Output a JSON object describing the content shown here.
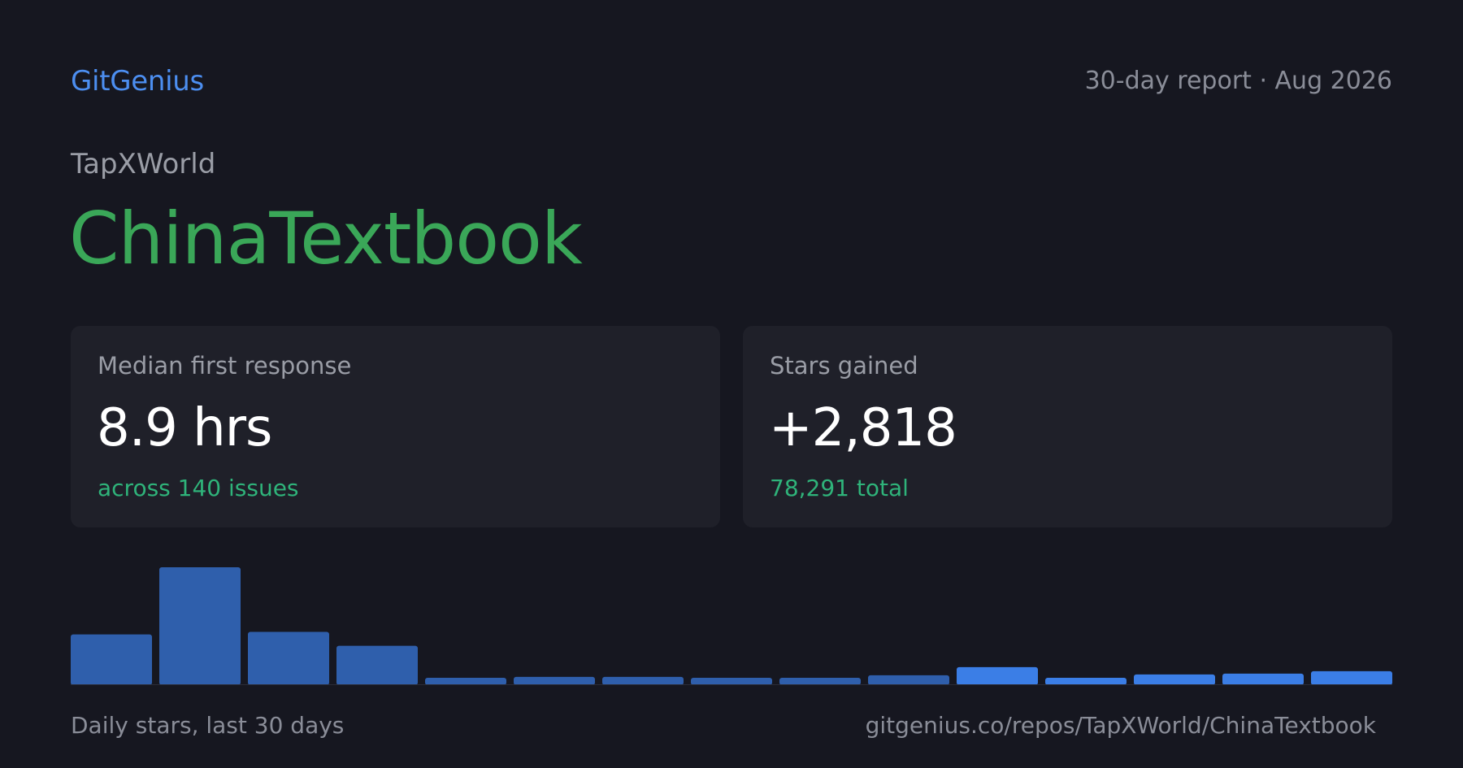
{
  "header": {
    "brand": "GitGenius",
    "report_label": "30-day report · Aug 2026"
  },
  "repo": {
    "owner": "TapXWorld",
    "name": "ChinaTextbook"
  },
  "cards": [
    {
      "label": "Median first response",
      "value": "8.9 hrs",
      "sub": "across 140 issues"
    },
    {
      "label": "Stars gained",
      "value": "+2,818",
      "sub": "78,291 total"
    }
  ],
  "footer": {
    "caption": "Daily stars, last 30 days",
    "url": "gitgenius.co/repos/TapXWorld/ChinaTextbook"
  },
  "colors": {
    "background": "#161720",
    "card": "#1f2029",
    "accent_blue": "#4c8ef0",
    "repo_green": "#3aa758",
    "sub_green": "#2fb37a",
    "bar_old": "#2f5fac",
    "bar_new": "#3b7ee6"
  },
  "chart_data": {
    "type": "bar",
    "values": [
      62,
      144,
      65,
      48,
      9,
      10,
      10,
      9,
      9,
      12,
      22,
      9,
      13,
      14,
      17
    ],
    "ylim": [
      0,
      144
    ]
  }
}
